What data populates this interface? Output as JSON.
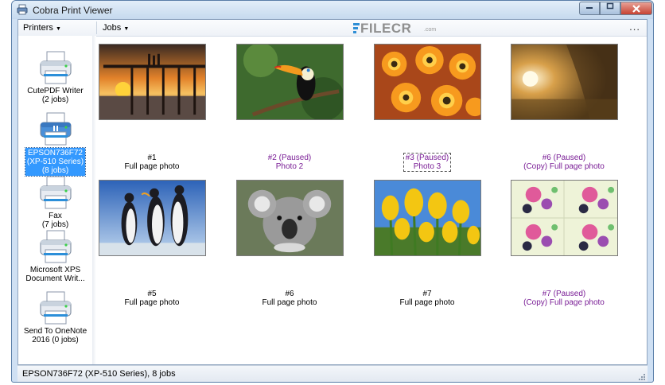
{
  "window": {
    "title": "Cobra Print Viewer"
  },
  "menubar": {
    "printers_label": "Printers",
    "jobs_label": "Jobs",
    "more_label": "..."
  },
  "watermark": {
    "text": "FILECR",
    "sub": ".com"
  },
  "printers": [
    {
      "label": "CutePDF Writer\n(2 jobs)",
      "selected": false
    },
    {
      "label": "EPSON736F72\n(XP-510 Series)\n(8 jobs)",
      "selected": true
    },
    {
      "label": "Fax\n(7 jobs)",
      "selected": false
    },
    {
      "label": "Microsoft XPS\nDocument Writ...",
      "selected": false
    },
    {
      "label": "Send To OneNote\n2016 (0 jobs)",
      "selected": false
    }
  ],
  "jobs": [
    {
      "line1": "#1",
      "line2": "Full page photo",
      "paused": false,
      "image": "pier-sunset"
    },
    {
      "line1": "#2  (Paused)",
      "line2": "Photo 2",
      "paused": true,
      "image": "toucan"
    },
    {
      "line1": "#3  (Paused)",
      "line2": "Photo 3",
      "paused": true,
      "image": "orange-flowers"
    },
    {
      "line1": "#6  (Paused)",
      "line2": "(Copy) Full page photo",
      "paused": true,
      "image": "golden-waterfall"
    },
    {
      "line1": "#5",
      "line2": "Full page photo",
      "paused": false,
      "image": "penguins"
    },
    {
      "line1": "#6",
      "line2": "Full page photo",
      "paused": false,
      "image": "koala"
    },
    {
      "line1": "#7",
      "line2": "Full page photo",
      "paused": false,
      "image": "yellow-tulips"
    },
    {
      "line1": "#7  (Paused)",
      "line2": "(Copy) Full page photo",
      "paused": true,
      "image": "flower-collage"
    }
  ],
  "status": {
    "text": "EPSON736F72 (XP-510 Series), 8 jobs"
  },
  "colors": {
    "paused_text": "#7a1e96",
    "selection": "#3399ff",
    "titlebar": "#c5d9ee"
  }
}
